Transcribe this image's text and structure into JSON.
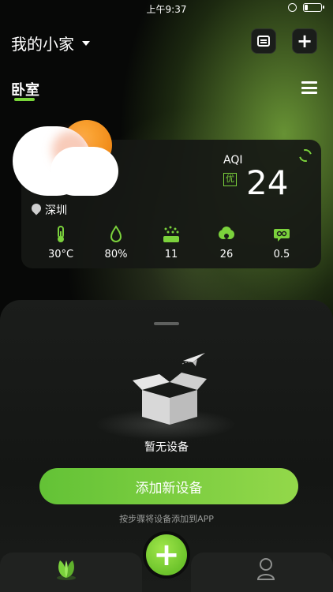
{
  "status_bar": {
    "time": "上午9:37"
  },
  "header": {
    "home_name": "我的小家"
  },
  "room": {
    "active_tab": "卧室"
  },
  "weather": {
    "city": "深圳",
    "aqi_label": "AQI",
    "aqi_level": "优",
    "aqi_value": "24",
    "metrics": [
      {
        "icon": "thermometer-icon",
        "value": "30°C"
      },
      {
        "icon": "humidity-drop-icon",
        "value": "80%"
      },
      {
        "icon": "pm25-icon",
        "value": "11"
      },
      {
        "icon": "ozone-icon",
        "value": "26"
      },
      {
        "icon": "co-icon",
        "value": "0.5"
      }
    ]
  },
  "empty_state": {
    "message": "暂无设备",
    "add_button": "添加新设备",
    "hint": "按步骤将设备添加到APP"
  },
  "colors": {
    "accent": "#7bd23c",
    "button_start": "#63c236",
    "button_end": "#93d84a"
  }
}
